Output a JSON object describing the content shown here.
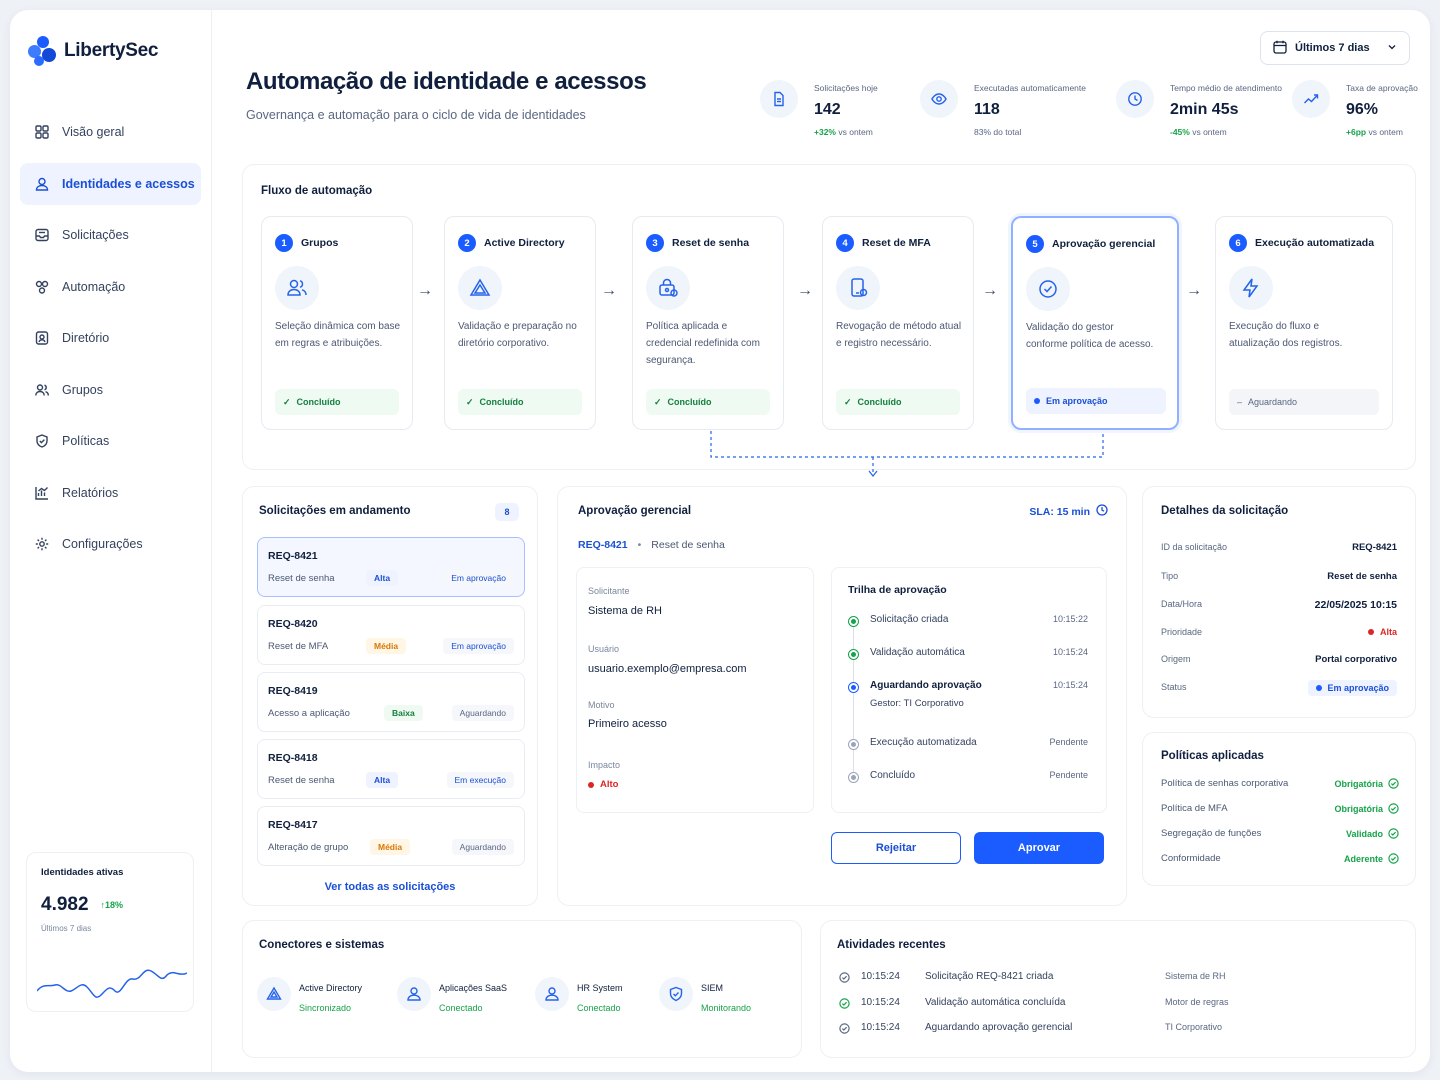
{
  "brand": {
    "name": "LibertySec",
    "accent": "#1a5cff"
  },
  "sidebar": {
    "items": [
      {
        "label": "Visão geral",
        "icon": "grid-icon"
      },
      {
        "label": "Identidades e acessos",
        "icon": "user-icon"
      },
      {
        "label": "Solicitações",
        "icon": "inbox-icon"
      },
      {
        "label": "Automação",
        "icon": "automation-icon"
      },
      {
        "label": "Diretório",
        "icon": "directory-icon"
      },
      {
        "label": "Grupos",
        "icon": "users-icon"
      },
      {
        "label": "Políticas",
        "icon": "shield-icon"
      },
      {
        "label": "Relatórios",
        "icon": "chart-icon"
      },
      {
        "label": "Configurações",
        "icon": "gear-icon"
      }
    ],
    "identity_card": {
      "title": "Identidades ativas",
      "value": "4.982",
      "delta": "18%",
      "period": "Últimos 7 dias"
    }
  },
  "header": {
    "title": "Automação de identidade e acessos",
    "subtitle": "Governança e automação para o ciclo de vida de identidades",
    "date_range": "Últimos 7 dias"
  },
  "kpis": [
    {
      "label": "Solicitações hoje",
      "value": "142",
      "delta": "+32%",
      "delta_text": "vs ontem",
      "icon": "document-icon"
    },
    {
      "label": "Executadas automaticamente",
      "value": "118",
      "delta": "",
      "delta_text": "83% do total",
      "icon": "eye-icon"
    },
    {
      "label": "Tempo médio de atendimento",
      "value": "2min 45s",
      "delta": "-45%",
      "delta_text": "vs ontem",
      "icon": "clock-icon"
    },
    {
      "label": "Taxa de aprovação",
      "value": "96%",
      "delta": "+6pp",
      "delta_text": "vs ontem",
      "icon": "trend-icon"
    }
  ],
  "flow": {
    "title": "Fluxo de automação",
    "steps": [
      {
        "num": "1",
        "title": "Grupos",
        "desc": "Seleção dinâmica com base em regras e atribuições.",
        "status": "Concluído"
      },
      {
        "num": "2",
        "title": "Active Directory",
        "desc": "Validação e preparação no diretório corporativo.",
        "status": "Concluído"
      },
      {
        "num": "3",
        "title": "Reset de senha",
        "desc": "Política aplicada e credencial redefinida com segurança.",
        "status": "Concluído"
      },
      {
        "num": "4",
        "title": "Reset de MFA",
        "desc": "Revogação de método atual e registro necessário.",
        "status": "Concluído"
      },
      {
        "num": "5",
        "title": "Aprovação gerencial",
        "desc": "Validação do gestor conforme política de acesso.",
        "status": "Em aprovação"
      },
      {
        "num": "6",
        "title": "Execução automatizada",
        "desc": "Execução do fluxo e atualização dos registros.",
        "status": "Aguardando"
      }
    ]
  },
  "requests": {
    "title": "Solicitações em andamento",
    "count": "8",
    "items": [
      {
        "id": "REQ-8421",
        "type": "Reset de senha",
        "priority": "Alta",
        "status": "Em aprovação"
      },
      {
        "id": "REQ-8420",
        "type": "Reset de MFA",
        "priority": "Média",
        "status": "Em aprovação"
      },
      {
        "id": "REQ-8419",
        "type": "Acesso a aplicação",
        "priority": "Baixa",
        "status": "Aguardando"
      },
      {
        "id": "REQ-8418",
        "type": "Reset de senha",
        "priority": "Alta",
        "status": "Em execução"
      },
      {
        "id": "REQ-8417",
        "type": "Alteração de grupo",
        "priority": "Média",
        "status": "Aguardando"
      }
    ],
    "view_all": "Ver todas as solicitações"
  },
  "approval": {
    "title": "Aprovação gerencial",
    "sla": "SLA: 15 min",
    "ref_id": "REQ-8421",
    "ref_type": "Reset de senha",
    "fields": [
      {
        "label": "Solicitante",
        "value": "Sistema de RH"
      },
      {
        "label": "Usuário",
        "value": "usuario.exemplo@empresa.com"
      },
      {
        "label": "Motivo",
        "value": "Primeiro acesso"
      },
      {
        "label": "Impacto",
        "value": "Alto"
      }
    ],
    "trail_title": "Trilha de aprovação",
    "trail": [
      {
        "text": "Solicitação criada",
        "time": "10:15:22",
        "state": "done"
      },
      {
        "text": "Validação automática",
        "time": "10:15:24",
        "state": "done"
      },
      {
        "text": "Aguardando aprovação",
        "sub": "Gestor: TI Corporativo",
        "time": "10:15:24",
        "state": "current"
      },
      {
        "text": "Execução automatizada",
        "time": "Pendente",
        "state": "pending"
      },
      {
        "text": "Concluído",
        "time": "Pendente",
        "state": "pending"
      }
    ],
    "reject": "Rejeitar",
    "approve": "Aprovar"
  },
  "details": {
    "title": "Detalhes da solicitação",
    "rows": [
      {
        "k": "ID da solicitação",
        "v": "REQ-8421"
      },
      {
        "k": "Tipo",
        "v": "Reset de senha"
      },
      {
        "k": "Data/Hora",
        "v": "22/05/2025 10:15"
      },
      {
        "k": "Prioridade",
        "v": "Alta"
      },
      {
        "k": "Origem",
        "v": "Portal corporativo"
      },
      {
        "k": "Status",
        "v": "Em aprovação"
      }
    ]
  },
  "policies": {
    "title": "Políticas aplicadas",
    "rows": [
      {
        "k": "Política de senhas corporativa",
        "v": "Obrigatória"
      },
      {
        "k": "Política de MFA",
        "v": "Obrigatória"
      },
      {
        "k": "Segregação de funções",
        "v": "Validado"
      },
      {
        "k": "Conformidade",
        "v": "Aderente"
      }
    ]
  },
  "connectors": {
    "title": "Conectores e sistemas",
    "items": [
      {
        "name": "Active Directory",
        "status": "Sincronizado",
        "icon": "triangle-icon"
      },
      {
        "name": "Aplicações SaaS",
        "status": "Conectado",
        "icon": "user-icon"
      },
      {
        "name": "HR System",
        "status": "Conectado",
        "icon": "user-icon"
      },
      {
        "name": "SIEM",
        "status": "Monitorando",
        "icon": "shield-icon"
      }
    ]
  },
  "activities": {
    "title": "Atividades recentes",
    "items": [
      {
        "time": "10:15:24",
        "text": "Solicitação REQ-8421 criada",
        "source": "Sistema de RH"
      },
      {
        "time": "10:15:24",
        "text": "Validação automática concluída",
        "source": "Motor de regras"
      },
      {
        "time": "10:15:24",
        "text": "Aguardando aprovação gerencial",
        "source": "TI Corporativo"
      }
    ]
  }
}
